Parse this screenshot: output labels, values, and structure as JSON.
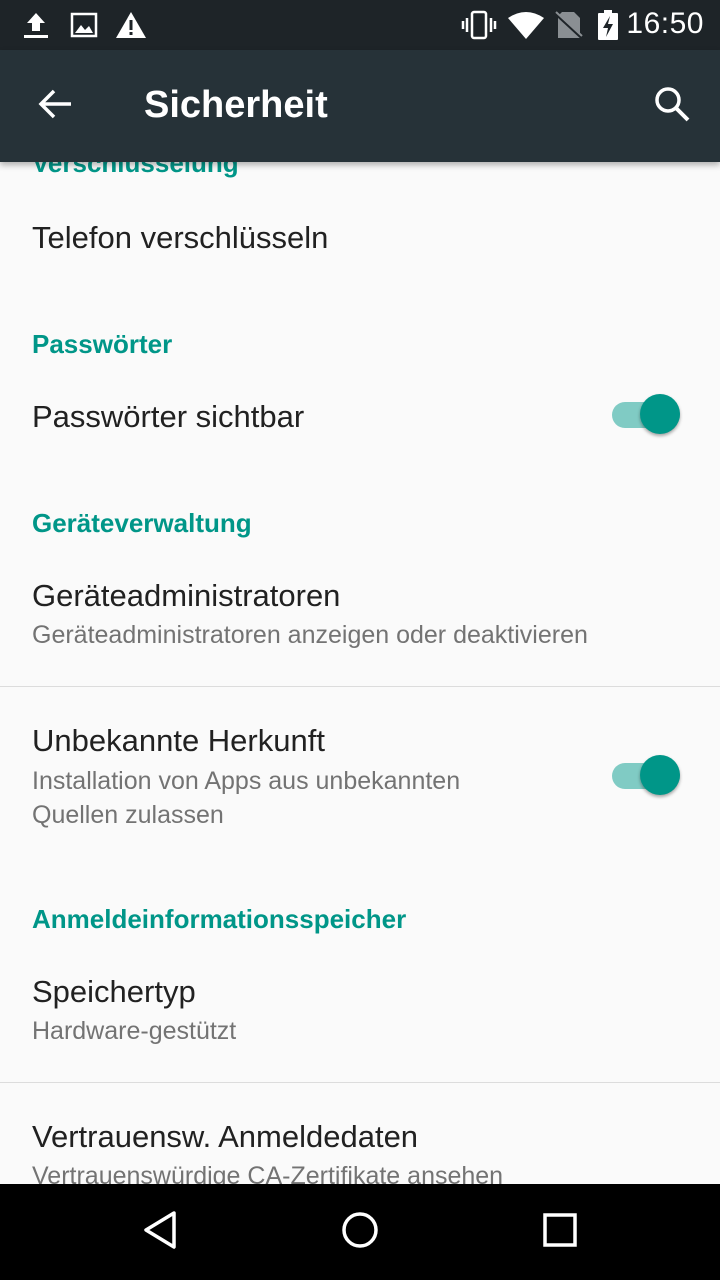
{
  "status_bar": {
    "time": "16:50",
    "left_icons": [
      "upload-icon",
      "image-icon",
      "warning-icon"
    ],
    "right_icons": [
      "vibrate-icon",
      "wifi-icon",
      "no-sim-icon",
      "battery-charging-icon"
    ]
  },
  "app_bar": {
    "title": "Sicherheit",
    "back_icon": "arrow-back-icon",
    "search_icon": "search-icon"
  },
  "sections": {
    "encryption": {
      "header": "Verschlüsselung",
      "items": [
        {
          "title": "Telefon verschlüsseln"
        }
      ]
    },
    "passwords": {
      "header": "Passwörter",
      "items": [
        {
          "title": "Passwörter sichtbar",
          "toggle": true
        }
      ]
    },
    "device_admin": {
      "header": "Geräteverwaltung",
      "items": [
        {
          "title": "Geräteadministratoren",
          "summary": "Geräteadministratoren anzeigen oder deaktivieren"
        },
        {
          "title": "Unbekannte Herkunft",
          "summary_line1": "Installation von Apps aus unbekannten",
          "summary_line2": "Quellen zulassen",
          "toggle": true
        }
      ]
    },
    "credentials": {
      "header": "Anmeldeinformationsspeicher",
      "items": [
        {
          "title": "Speichertyp",
          "summary": "Hardware-gestützt"
        },
        {
          "title": "Vertrauensw. Anmeldedaten",
          "summary": "Vertrauenswürdige CA-Zertifikate ansehen"
        }
      ]
    }
  },
  "colors": {
    "accent": "#009688",
    "toolbar": "#263238",
    "status_bar": "#1e2428"
  },
  "nav_bar": {
    "buttons": [
      "back-triangle-icon",
      "home-circle-icon",
      "recents-square-icon"
    ]
  }
}
